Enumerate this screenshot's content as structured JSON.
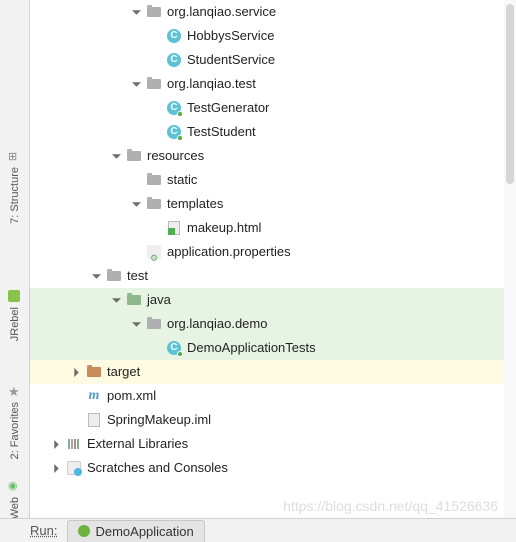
{
  "sidebar": {
    "structure": "7: Structure",
    "jrebel": "JRebel",
    "favorites": "2: Favorites",
    "web": "Web"
  },
  "tree": {
    "service_pkg": "org.lanqiao.service",
    "hobbys_service": "HobbysService",
    "student_service": "StudentService",
    "test_pkg": "org.lanqiao.test",
    "test_generator": "TestGenerator",
    "test_student": "TestStudent",
    "resources": "resources",
    "static": "static",
    "templates": "templates",
    "makeup_html": "makeup.html",
    "app_props": "application.properties",
    "test": "test",
    "java": "java",
    "demo_pkg": "org.lanqiao.demo",
    "demo_app_tests": "DemoApplicationTests",
    "target": "target",
    "pom": "pom.xml",
    "iml": "SpringMakeup.iml",
    "ext_lib": "External Libraries",
    "scratches": "Scratches and Consoles"
  },
  "bottom": {
    "run_label": "Run:",
    "tab": "DemoApplication"
  },
  "watermark": "https://blog.csdn.net/qq_41526636"
}
